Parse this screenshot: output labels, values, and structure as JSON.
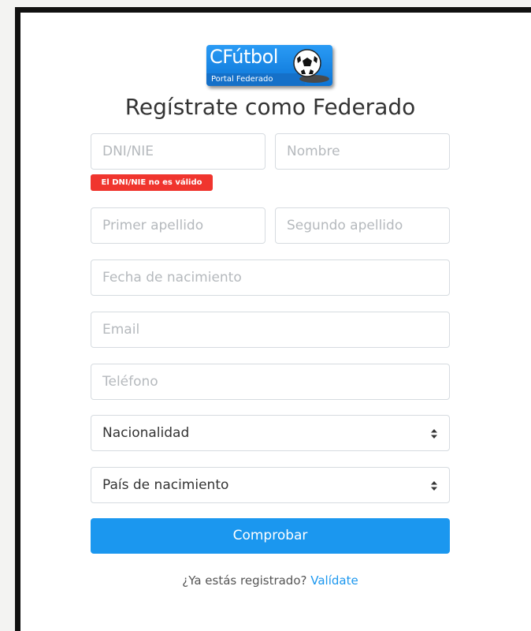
{
  "logo": {
    "name": "CFútbol",
    "subtitle": "Portal Federado"
  },
  "title": "Regístrate como Federado",
  "form": {
    "dni_placeholder": "DNI/NIE",
    "nombre_placeholder": "Nombre",
    "dni_error": "El DNI/NIE no es válido",
    "apellido1_placeholder": "Primer apellido",
    "apellido2_placeholder": "Segundo apellido",
    "fecha_placeholder": "Fecha de nacimiento",
    "email_placeholder": "Email",
    "telefono_placeholder": "Teléfono",
    "nacionalidad_value": "Nacionalidad",
    "pais_value": "País de nacimiento",
    "submit_label": "Comprobar"
  },
  "footer": {
    "question": "¿Ya estás registrado?",
    "link": "Valídate"
  },
  "colors": {
    "accent": "#1b97ef",
    "error": "#f0352e",
    "text": "#333333",
    "placeholder": "#b5b9bd"
  }
}
